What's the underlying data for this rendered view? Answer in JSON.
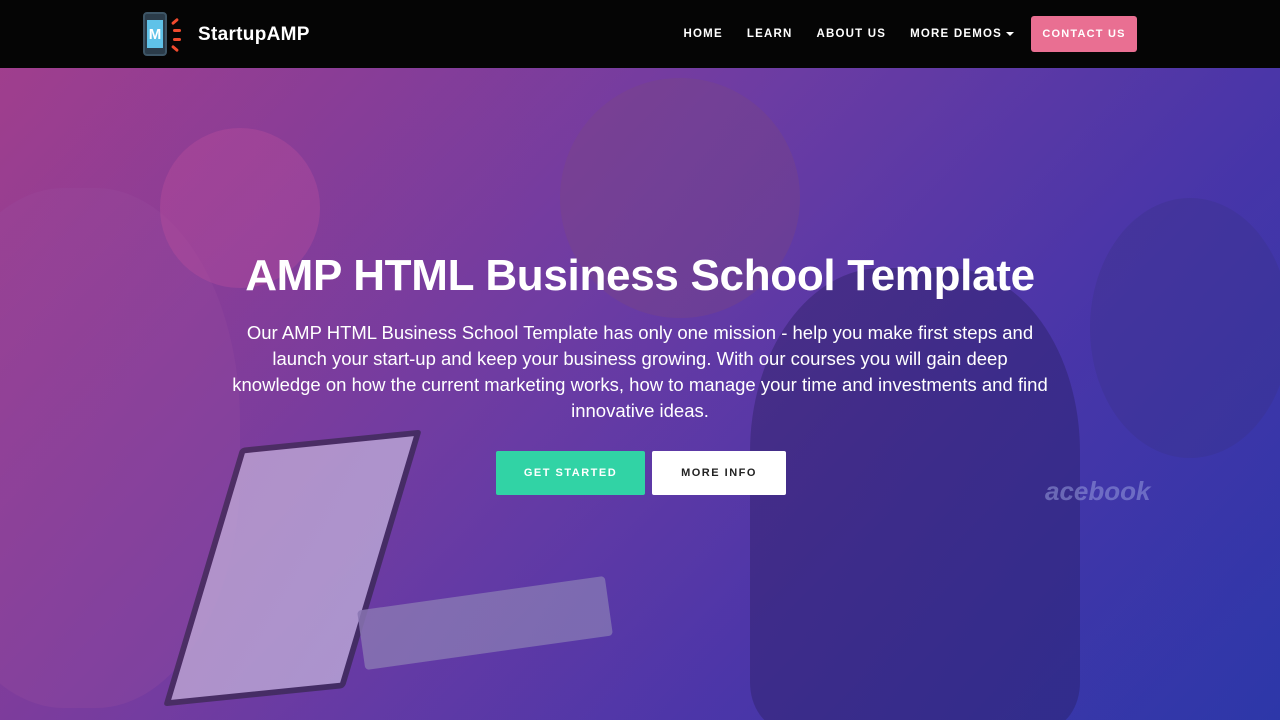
{
  "brand": {
    "logo_letter": "M",
    "name": "StartupAMP"
  },
  "nav": {
    "items": [
      "HOME",
      "LEARN",
      "ABOUT US",
      "MORE DEMOS"
    ],
    "contact_label": "CONTACT US"
  },
  "hero": {
    "title": "AMP HTML Business School Template",
    "text": "Our AMP HTML Business School Template has only one mission - help you make first steps and launch your start-up and keep your business growing. With our courses you will gain deep knowledge on how the current marketing works, how to manage your time and investments and find innovative ideas.",
    "primary_button": "GET STARTED",
    "secondary_button": "MORE INFO",
    "background_text": "acebook"
  },
  "colors": {
    "navbar": "#050505",
    "contact_button": "#e96f92",
    "primary_button": "#31d3a5",
    "secondary_button": "#ffffff",
    "hero_gradient_start": "#9a3f8e",
    "hero_gradient_end": "#2f3aa8"
  },
  "icons": {
    "logo": "phone-logo-icon",
    "dropdown": "caret-down-icon"
  }
}
